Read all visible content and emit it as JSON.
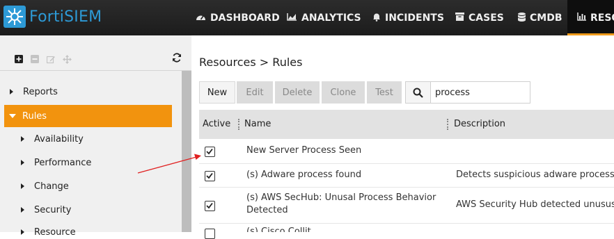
{
  "app": {
    "name": "FortiSIEM"
  },
  "nav": {
    "dashboard": "DASHBOARD",
    "analytics": "ANALYTICS",
    "incidents": "INCIDENTS",
    "cases": "CASES",
    "cmdb": "CMDB",
    "resources": "RESO"
  },
  "sidebar": {
    "items": [
      {
        "label": "Reports"
      },
      {
        "label": "Rules"
      },
      {
        "label": "Availability"
      },
      {
        "label": "Performance"
      },
      {
        "label": "Change"
      },
      {
        "label": "Security"
      },
      {
        "label": "Resource"
      }
    ]
  },
  "breadcrumb": "Resources > Rules",
  "toolbar": {
    "new": "New",
    "edit": "Edit",
    "delete": "Delete",
    "clone": "Clone",
    "test": "Test"
  },
  "search": {
    "value": "process"
  },
  "table": {
    "columns": [
      "Active",
      "Name",
      "Description"
    ],
    "rows": [
      {
        "active": true,
        "name": "New Server Process Seen",
        "name2": "",
        "description": ""
      },
      {
        "active": true,
        "name": "(s) Adware process found",
        "name2": "",
        "description": "Detects suspicious adware process o"
      },
      {
        "active": true,
        "name": "(s) AWS SecHub: Unusal Process Behavior",
        "name2": "Detected",
        "description": "AWS Security Hub detected unususl p"
      },
      {
        "active": true,
        "name": "(s) Cisco Collit...",
        "name2": "",
        "description": "..."
      }
    ]
  },
  "colors": {
    "accent": "#f2930e",
    "brand": "#2d9ad6",
    "annotation_arrow": "#e02020"
  }
}
